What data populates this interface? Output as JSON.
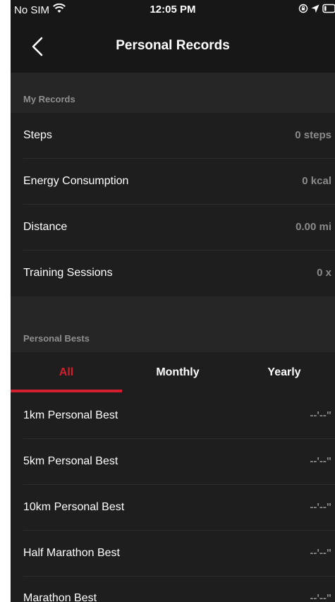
{
  "status_bar": {
    "carrier": "No SIM",
    "time": "12:05 PM"
  },
  "nav": {
    "title": "Personal Records"
  },
  "my_records": {
    "header": "My Records",
    "rows": [
      {
        "label": "Steps",
        "value": "0 steps"
      },
      {
        "label": "Energy Consumption",
        "value": "0 kcal"
      },
      {
        "label": "Distance",
        "value": "0.00 mi"
      },
      {
        "label": "Training Sessions",
        "value": "0 x"
      }
    ]
  },
  "personal_bests": {
    "header": "Personal Bests",
    "tabs": [
      {
        "label": "All",
        "active": true
      },
      {
        "label": "Monthly",
        "active": false
      },
      {
        "label": "Yearly",
        "active": false
      }
    ],
    "rows": [
      {
        "label": "1km Personal Best",
        "value": "--'--\""
      },
      {
        "label": "5km Personal Best",
        "value": "--'--\""
      },
      {
        "label": "10km Personal Best",
        "value": "--'--\""
      },
      {
        "label": "Half Marathon Best",
        "value": "--'--\""
      },
      {
        "label": "Marathon Best",
        "value": "--'--\""
      }
    ]
  },
  "colors": {
    "accent": "#d0202e",
    "background": "#1e1e1e",
    "section_header": "#262626",
    "muted_text": "#8a8a8a"
  }
}
